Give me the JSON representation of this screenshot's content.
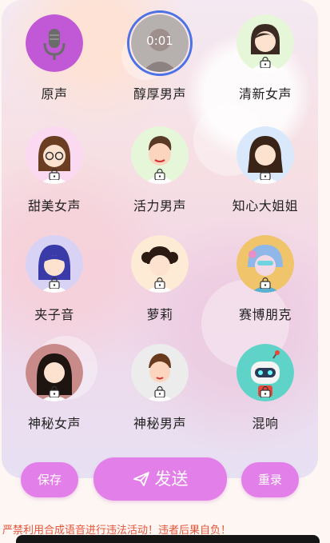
{
  "voices": [
    {
      "label": "原声",
      "avatar": "mic-icon",
      "locked": false
    },
    {
      "label": "醇厚男声",
      "avatar": "man-icon",
      "locked": false,
      "playing": true,
      "timer": "0:01"
    },
    {
      "label": "清新女声",
      "avatar": "woman-icon",
      "locked": true
    },
    {
      "label": "甜美女声",
      "avatar": "girl-glasses-icon",
      "locked": true
    },
    {
      "label": "活力男声",
      "avatar": "man-icon",
      "locked": true
    },
    {
      "label": "知心大姐姐",
      "avatar": "woman-icon",
      "locked": true
    },
    {
      "label": "夹子音",
      "avatar": "girl-blue-hair-icon",
      "locked": true
    },
    {
      "label": "萝莉",
      "avatar": "girl-icon",
      "locked": true
    },
    {
      "label": "赛博朋克",
      "avatar": "cyber-girl-icon",
      "locked": true
    },
    {
      "label": "神秘女声",
      "avatar": "woman-long-hair-icon",
      "locked": true
    },
    {
      "label": "神秘男声",
      "avatar": "boy-icon",
      "locked": true
    },
    {
      "label": "混响",
      "avatar": "robot-icon",
      "locked": true
    }
  ],
  "buttons": {
    "save": "保存",
    "send": "发送",
    "reset": "重录"
  },
  "warning": "严禁利用合成语音进行违法活动！违者后果自负！",
  "colors": {
    "accent": "#e37fe8",
    "warning": "#e5553a",
    "playing_ring": "#4d72e6"
  }
}
